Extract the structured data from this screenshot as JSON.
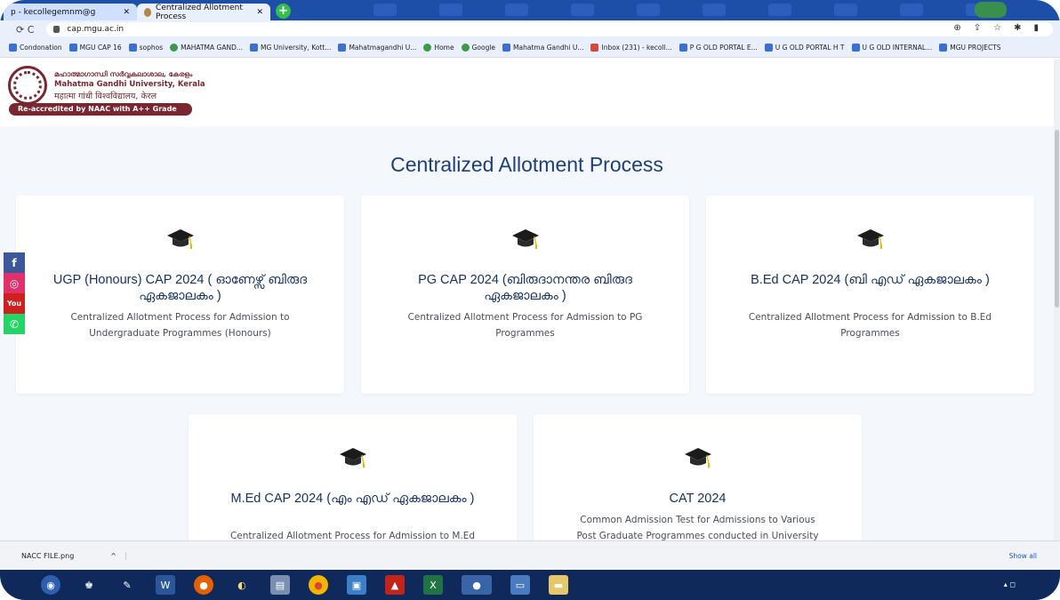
{
  "browser": {
    "tabs": [
      {
        "label": "p - kecollegemnm@g",
        "active": false
      },
      {
        "label": "Centralized Allotment Process",
        "active": true
      }
    ],
    "new_tab": "+",
    "url": "cap.mgu.ac.in",
    "bookmarks": [
      {
        "label": "Condonation",
        "icon": "blue"
      },
      {
        "label": "MGU CAP 16",
        "icon": "blue"
      },
      {
        "label": "sophos",
        "icon": "blue"
      },
      {
        "label": "MAHATMA GAND...",
        "icon": "globe"
      },
      {
        "label": "MG University, Kott...",
        "icon": "blue"
      },
      {
        "label": "Mahatmagandhi U...",
        "icon": "blue"
      },
      {
        "label": "Home",
        "icon": "globe"
      },
      {
        "label": "Google",
        "icon": "globe"
      },
      {
        "label": "Mahatma Gandhi U...",
        "icon": "blue"
      },
      {
        "label": "Inbox (231) - kecoll...",
        "icon": "mail"
      },
      {
        "label": "P G OLD PORTAL E...",
        "icon": "blue"
      },
      {
        "label": "U G OLD PORTAL H T",
        "icon": "blue"
      },
      {
        "label": "U G OLD INTERNAL...",
        "icon": "blue"
      },
      {
        "label": "MGU PROJECTS",
        "icon": "blue"
      }
    ]
  },
  "header": {
    "name_ml": "മഹാത്മാഗാന്ധി സർവ്വകലാശാല, കേരളം",
    "name_en": "Mahatma Gandhi University, Kerala",
    "name_hi": "महात्मा गांधी विश्वविद्यालय, केरल",
    "badge": "Re-accredited by NAAC with A++ Grade"
  },
  "main": {
    "title": "Centralized Allotment Process",
    "cards": [
      {
        "title": "UGP (Honours) CAP 2024 ( ഓണേഴ്സ് ബിരുദ ഏകജാലകം )",
        "desc": "Centralized Allotment Process for Admission to Undergraduate Programmes (Honours)"
      },
      {
        "title": "PG CAP 2024 (ബിരുദാനന്തര ബിരുദ ഏകജാലകം )",
        "desc": "Centralized Allotment Process for Admission to PG Programmes"
      },
      {
        "title": "B.Ed CAP 2024 (ബി എഡ് ഏകജാലകം )",
        "desc": "Centralized Allotment Process for Admission to B.Ed Programmes"
      },
      {
        "title": "M.Ed CAP 2024 (എം എഡ് ഏകജാലകം )",
        "desc": "Centralized Allotment Process for Admission to M.Ed"
      },
      {
        "title": "CAT 2024",
        "desc": "Common Admission Test for Admissions to Various Post Graduate Programmes conducted in University"
      }
    ]
  },
  "social": {
    "facebook": "f",
    "instagram": "◎",
    "youtube": "You",
    "whatsapp": "✆"
  },
  "downloads": {
    "file": "NACC FILE.png",
    "chevron": "^",
    "show_all": "Show all"
  },
  "taskbar": {
    "tray": "▴ ◻"
  },
  "colors": {
    "title_blue": "#1d3f7a",
    "maroon": "#7a2630",
    "page_bg": "#f4f7fc"
  }
}
